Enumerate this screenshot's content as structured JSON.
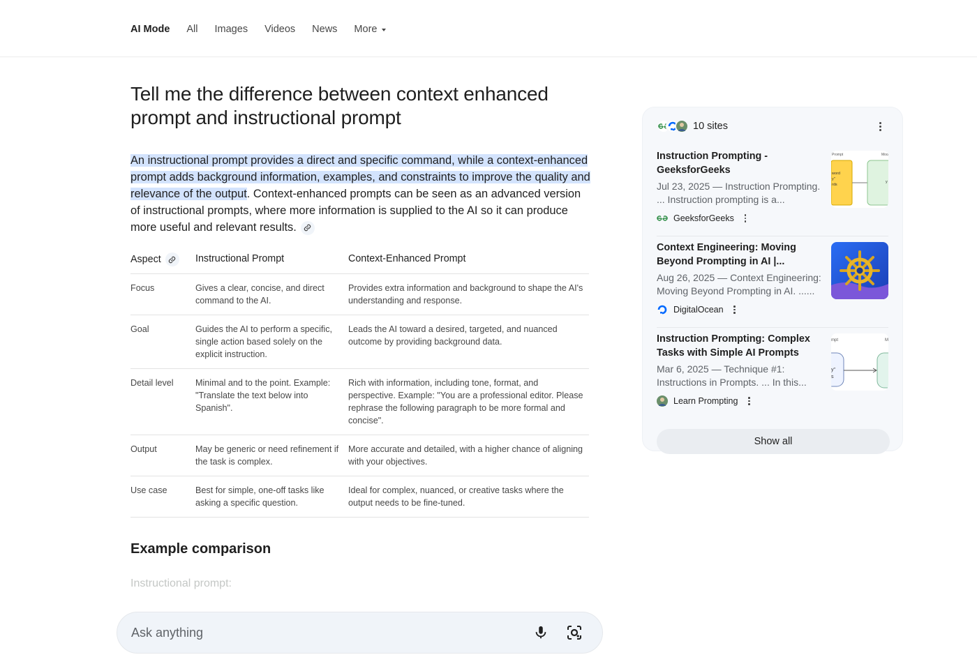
{
  "nav": {
    "tabs": [
      {
        "label": "AI Mode",
        "active": true
      },
      {
        "label": "All"
      },
      {
        "label": "Images"
      },
      {
        "label": "Videos"
      },
      {
        "label": "News"
      },
      {
        "label": "More"
      }
    ]
  },
  "question": "Tell me the difference between context enhanced prompt and instructional prompt",
  "answer": {
    "highlighted": "An instructional prompt provides a direct and specific command, while a context-enhanced prompt adds background information, examples, and constraints to improve the quality and relevance of the output",
    "rest": ". Context-enhanced prompts can be seen as an advanced version of instructional prompts, where more information is supplied to the AI so it can produce more useful and relevant results."
  },
  "table": {
    "headers": [
      "Aspect",
      "Instructional Prompt",
      "Context-Enhanced Prompt"
    ],
    "rows": [
      [
        "Focus",
        "Gives a clear, concise, and direct command to the AI.",
        "Provides extra information and background to shape the AI's understanding and response."
      ],
      [
        "Goal",
        "Guides the AI to perform a specific, single action based solely on the explicit instruction.",
        "Leads the AI toward a desired, targeted, and nuanced outcome by providing background data."
      ],
      [
        "Detail level",
        "Minimal and to the point. Example: \"Translate the text below into Spanish\".",
        "Rich with information, including tone, format, and perspective. Example: \"You are a professional editor. Please rephrase the following paragraph to be more formal and concise\"."
      ],
      [
        "Output",
        "May be generic or need refinement if the task is complex.",
        "More accurate and detailed, with a higher chance of aligning with your objectives."
      ],
      [
        "Use case",
        "Best for simple, one-off tasks like asking a specific question.",
        "Ideal for complex, nuanced, or creative tasks where the output needs to be fine-tuned."
      ]
    ]
  },
  "example_heading": "Example comparison",
  "faded_text": "Instructional prompt:",
  "askbar": {
    "placeholder": "Ask anything"
  },
  "sources": {
    "count_label": "10 sites",
    "items": [
      {
        "title": "Instruction Prompting - GeeksforGeeks",
        "snippet": "Jul 23, 2025 — Instruction Prompting. ... Instruction prompting is a...",
        "site": "GeeksforGeeks",
        "icon": "geeksforgeeks-icon"
      },
      {
        "title": "Context Engineering: Moving Beyond Prompting in AI |...",
        "snippet": "Aug 26, 2025 — Context Engineering: Moving Beyond Prompting in AI. ......",
        "site": "DigitalOcean",
        "icon": "digitalocean-icon"
      },
      {
        "title": "Instruction Prompting: Complex Tasks with Simple AI Prompts",
        "snippet": "Mar 6, 2025 — Technique #1: Instructions in Prompts. ... In this...",
        "site": "Learn Prompting",
        "icon": "learnprompting-icon"
      }
    ],
    "thumb_labels": {
      "t1_a": "Prompt",
      "t1_b": "Mod",
      "t1_c": "word",
      "t1_d": "y\"",
      "t1_e": "rds",
      "t1_f": "y",
      "t3_a": "mpt",
      "t3_b": "M",
      "t3_c": "y\"",
      "t3_d": "s"
    },
    "show_all": "Show all"
  },
  "colors": {
    "highlight": "#d3e3fd",
    "geeks_green": "#2f8d46",
    "digitalocean_blue": "#0069ff",
    "panel_bg": "#f6f8fb"
  }
}
